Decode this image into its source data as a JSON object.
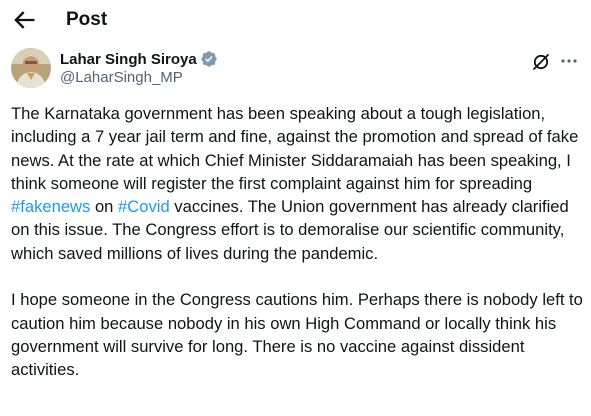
{
  "header": {
    "title": "Post",
    "back_icon": "arrow-left-icon"
  },
  "author": {
    "name": "Lahar Singh Siroya",
    "handle": "@LaharSingh_MP",
    "verified_color": "#829aab",
    "icons": [
      "verified-badge-icon",
      "grok-icon",
      "more-icon"
    ]
  },
  "post": {
    "p1_a": "The Karnataka government has been speaking about a tough legislation, including a 7 year jail term and fine, against the promotion and spread of fake news. At the rate at which Chief Minister Siddaramaiah has been speaking, I think someone will register the first complaint against him for spreading ",
    "hashtag1": "#fakenews",
    "p1_b": " on ",
    "hashtag2": "#Covid",
    "p1_c": " vaccines. The Union government has already clarified on this issue.  The Congress effort is to demoralise our scientific community, which saved millions of lives during the pandemic.",
    "p2": "I hope someone in the Congress cautions him. Perhaps there is nobody left to caution him because nobody in his own High Command or locally think his government will survive for long. There is no vaccine against dissident activities."
  },
  "colors": {
    "link": "#1d9bf0",
    "text": "#0f1419",
    "secondary": "#536471"
  }
}
